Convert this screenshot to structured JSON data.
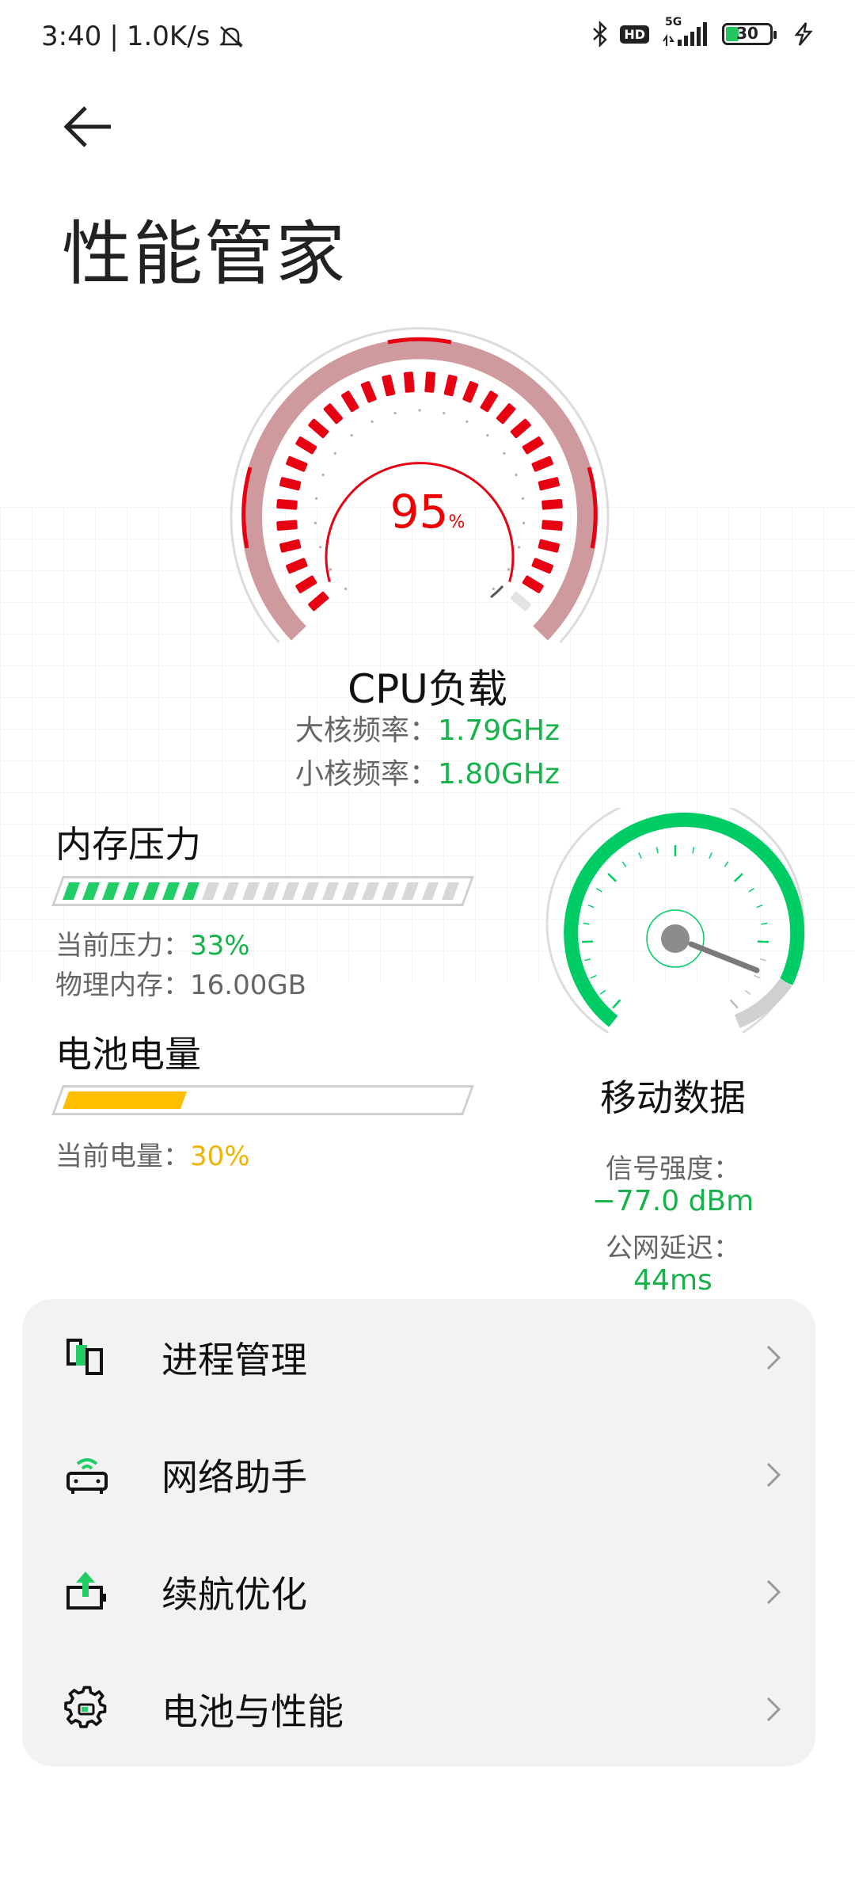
{
  "status_bar": {
    "time": "3:40",
    "net_speed": "1.0K/s",
    "net_type": "5G",
    "hd_label": "HD",
    "battery_level": "30",
    "icons": [
      "mute-icon",
      "bluetooth-icon",
      "hd-icon",
      "signal-icon",
      "battery-icon",
      "charging-icon"
    ]
  },
  "header": {
    "title": "性能管家",
    "back_icon": "back-arrow-icon"
  },
  "cpu": {
    "value": "95",
    "unit": "%",
    "label": "CPU负载",
    "big_core_label": "大核频率：",
    "big_core_value": "1.79GHz",
    "small_core_label": "小核频率：",
    "small_core_value": "1.80GHz",
    "load_fraction": 0.95,
    "color": "#e60012"
  },
  "memory": {
    "title": "内存压力",
    "pressure_label": "当前压力：",
    "pressure_value": "33%",
    "total_label": "物理内存：",
    "total_value": "16.00GB",
    "fill_fraction": 0.33,
    "color": "#22cc66"
  },
  "battery": {
    "title": "电池电量",
    "level_label": "当前电量：",
    "level_value": "30%",
    "fill_fraction": 0.3,
    "color": "#ffbe00"
  },
  "network": {
    "title": "移动数据",
    "signal_label": "信号强度：",
    "signal_value": "−77.0 dBm",
    "latency_label": "公网延迟：",
    "latency_value": "44ms",
    "color": "#00cc66"
  },
  "menu": {
    "items": [
      {
        "label": "进程管理",
        "icon": "process-icon"
      },
      {
        "label": "网络助手",
        "icon": "router-icon"
      },
      {
        "label": "续航优化",
        "icon": "battery-boost-icon"
      },
      {
        "label": "电池与性能",
        "icon": "gear-icon"
      }
    ]
  },
  "colors": {
    "accent_green": "#16b34a",
    "accent_red": "#e60012",
    "accent_yellow": "#ffbe00",
    "card_bg": "#f2f2f2"
  }
}
